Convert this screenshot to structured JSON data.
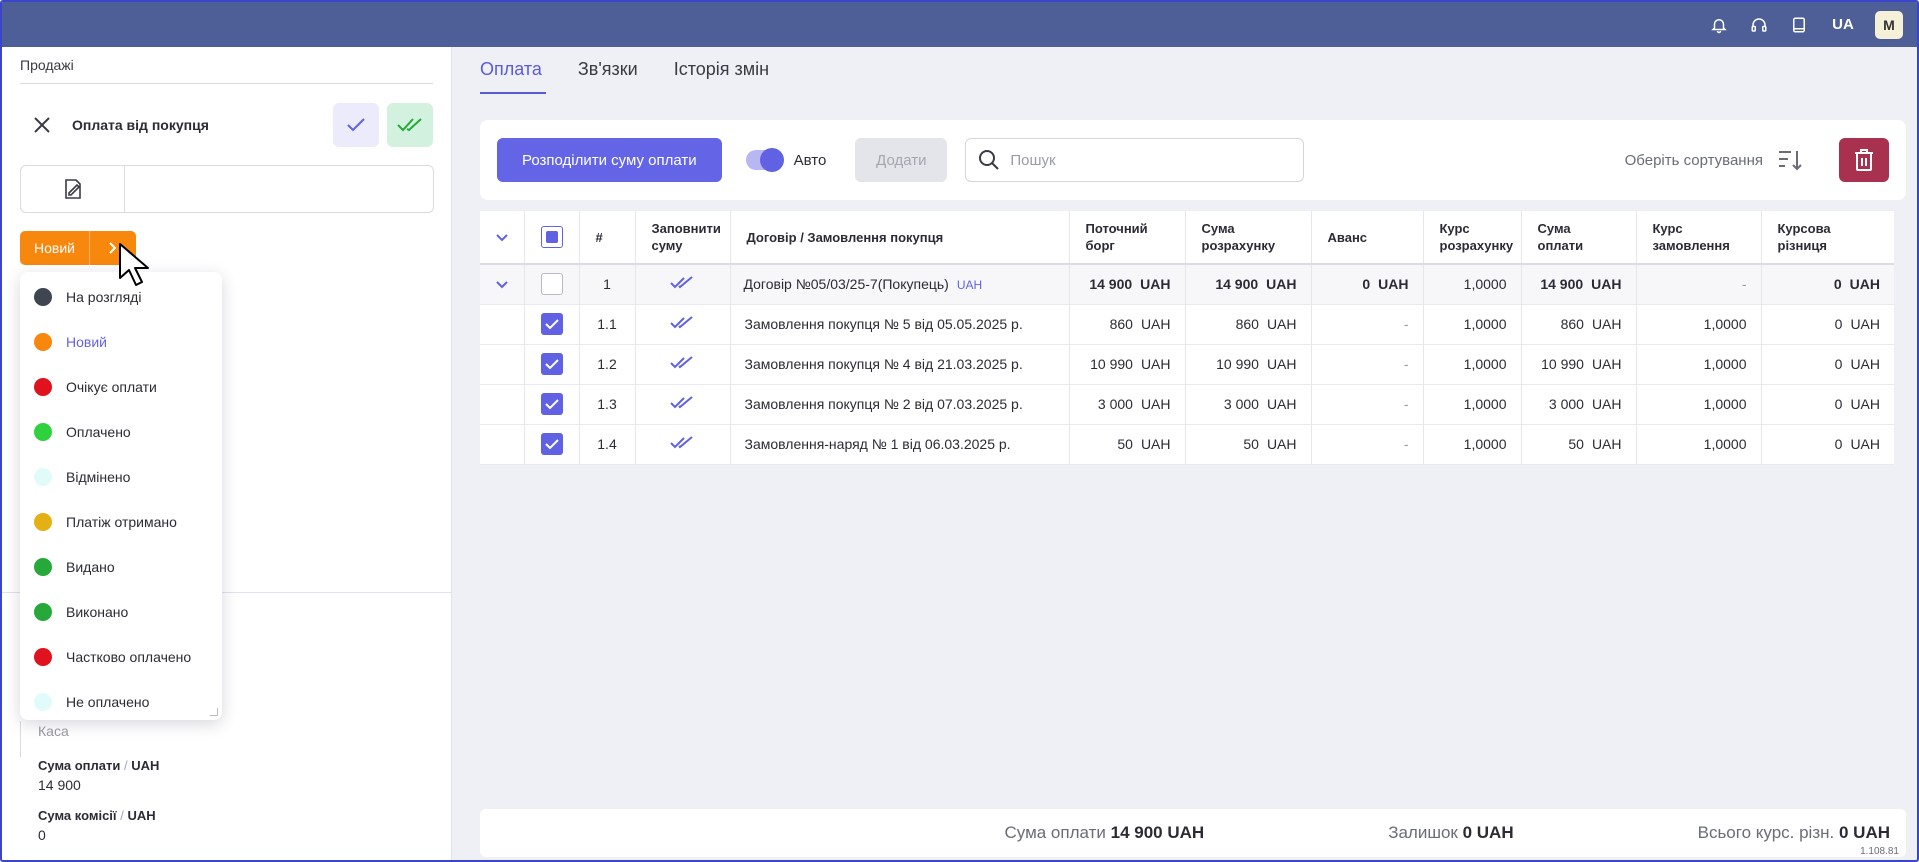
{
  "topbar": {
    "lang": "UA",
    "avatar": "M",
    "icons": [
      "bell-icon",
      "headset-icon",
      "book-icon"
    ]
  },
  "left": {
    "breadcrumb": "Продажі",
    "doc_title": "Оплата від покупця",
    "status_label": "Новий",
    "kasa_placeholder": "Каса",
    "amount_label": "Сума оплати",
    "amount_currency": "UAH",
    "amount_value": "14 900",
    "commission_label": "Сума комісії",
    "commission_currency": "UAH",
    "commission_value": "0"
  },
  "status_menu": [
    {
      "label": "На розгляді",
      "color": "#3f4651"
    },
    {
      "label": "Новий",
      "color": "#f7870d",
      "active": true
    },
    {
      "label": "Очікує оплати",
      "color": "#e0121d"
    },
    {
      "label": "Оплачено",
      "color": "#30d13f"
    },
    {
      "label": "Відмінено",
      "color": "#e1fbfa"
    },
    {
      "label": "Платіж отримано",
      "color": "#e5b014"
    },
    {
      "label": "Видано",
      "color": "#27a83a"
    },
    {
      "label": "Виконано",
      "color": "#27a83a"
    },
    {
      "label": "Частково оплачено",
      "color": "#e0121d"
    },
    {
      "label": "Не оплачено",
      "color": "#e1fbfa"
    }
  ],
  "tabs": [
    "Оплата",
    "Зв'язки",
    "Історія змін"
  ],
  "toolbar": {
    "distribute_label": "Розподілити суму оплати",
    "auto_label": "Авто",
    "add_label": "Додати",
    "search_placeholder": "Пошук",
    "sort_label": "Оберіть сортування"
  },
  "table": {
    "headers": {
      "num": "#",
      "fill_1": "Заповнити",
      "fill_2": "суму",
      "contract": "Договір / Замовлення покупця",
      "debt_1": "Поточний",
      "debt_2": "борг",
      "calc_1": "Сума",
      "calc_2": "розрахунку",
      "advance": "Аванс",
      "rate_1": "Курс",
      "rate_2": "розрахунку",
      "pay_1": "Сума",
      "pay_2": "оплати",
      "order_rate_1": "Курс",
      "order_rate_2": "замовлення",
      "diff_1": "Курсова",
      "diff_2": "різниця"
    },
    "parent": {
      "num": "1",
      "contract": "Договір №05/03/25-7(Покупець)",
      "tag": "UAH",
      "debt": "14 900",
      "calc": "14 900",
      "advance": "0",
      "rate": "1,0000",
      "pay": "14 900",
      "order_rate": "-",
      "diff": "0",
      "currency": "UAH"
    },
    "rows": [
      {
        "num": "1.1",
        "contract": "Замовлення покупця № 5 від 05.05.2025 р.",
        "debt": "860",
        "calc": "860",
        "advance": "-",
        "rate": "1,0000",
        "pay": "860",
        "order_rate": "1,0000",
        "diff": "0",
        "currency": "UAH"
      },
      {
        "num": "1.2",
        "contract": "Замовлення покупця № 4 від 21.03.2025 р.",
        "debt": "10 990",
        "calc": "10 990",
        "advance": "-",
        "rate": "1,0000",
        "pay": "10 990",
        "order_rate": "1,0000",
        "diff": "0",
        "currency": "UAH"
      },
      {
        "num": "1.3",
        "contract": "Замовлення покупця № 2 від 07.03.2025 р.",
        "debt": "3 000",
        "calc": "3 000",
        "advance": "-",
        "rate": "1,0000",
        "pay": "3 000",
        "order_rate": "1,0000",
        "diff": "0",
        "currency": "UAH"
      },
      {
        "num": "1.4",
        "contract": "Замовлення-наряд № 1 від 06.03.2025 р.",
        "debt": "50",
        "calc": "50",
        "advance": "-",
        "rate": "1,0000",
        "pay": "50",
        "order_rate": "1,0000",
        "diff": "0",
        "currency": "UAH"
      }
    ]
  },
  "footer": {
    "sum_label": "Сума оплати",
    "sum_value": "14 900 UAH",
    "rest_label": "Залишок",
    "rest_value": "0 UAH",
    "diff_label": "Всього курс. різн.",
    "diff_value": "0 UAH"
  },
  "version": "1.108.81",
  "colors": {
    "accent": "#6162e3",
    "topbar": "#4e5f98",
    "status": "#f7870d",
    "danger": "#a8314f"
  }
}
